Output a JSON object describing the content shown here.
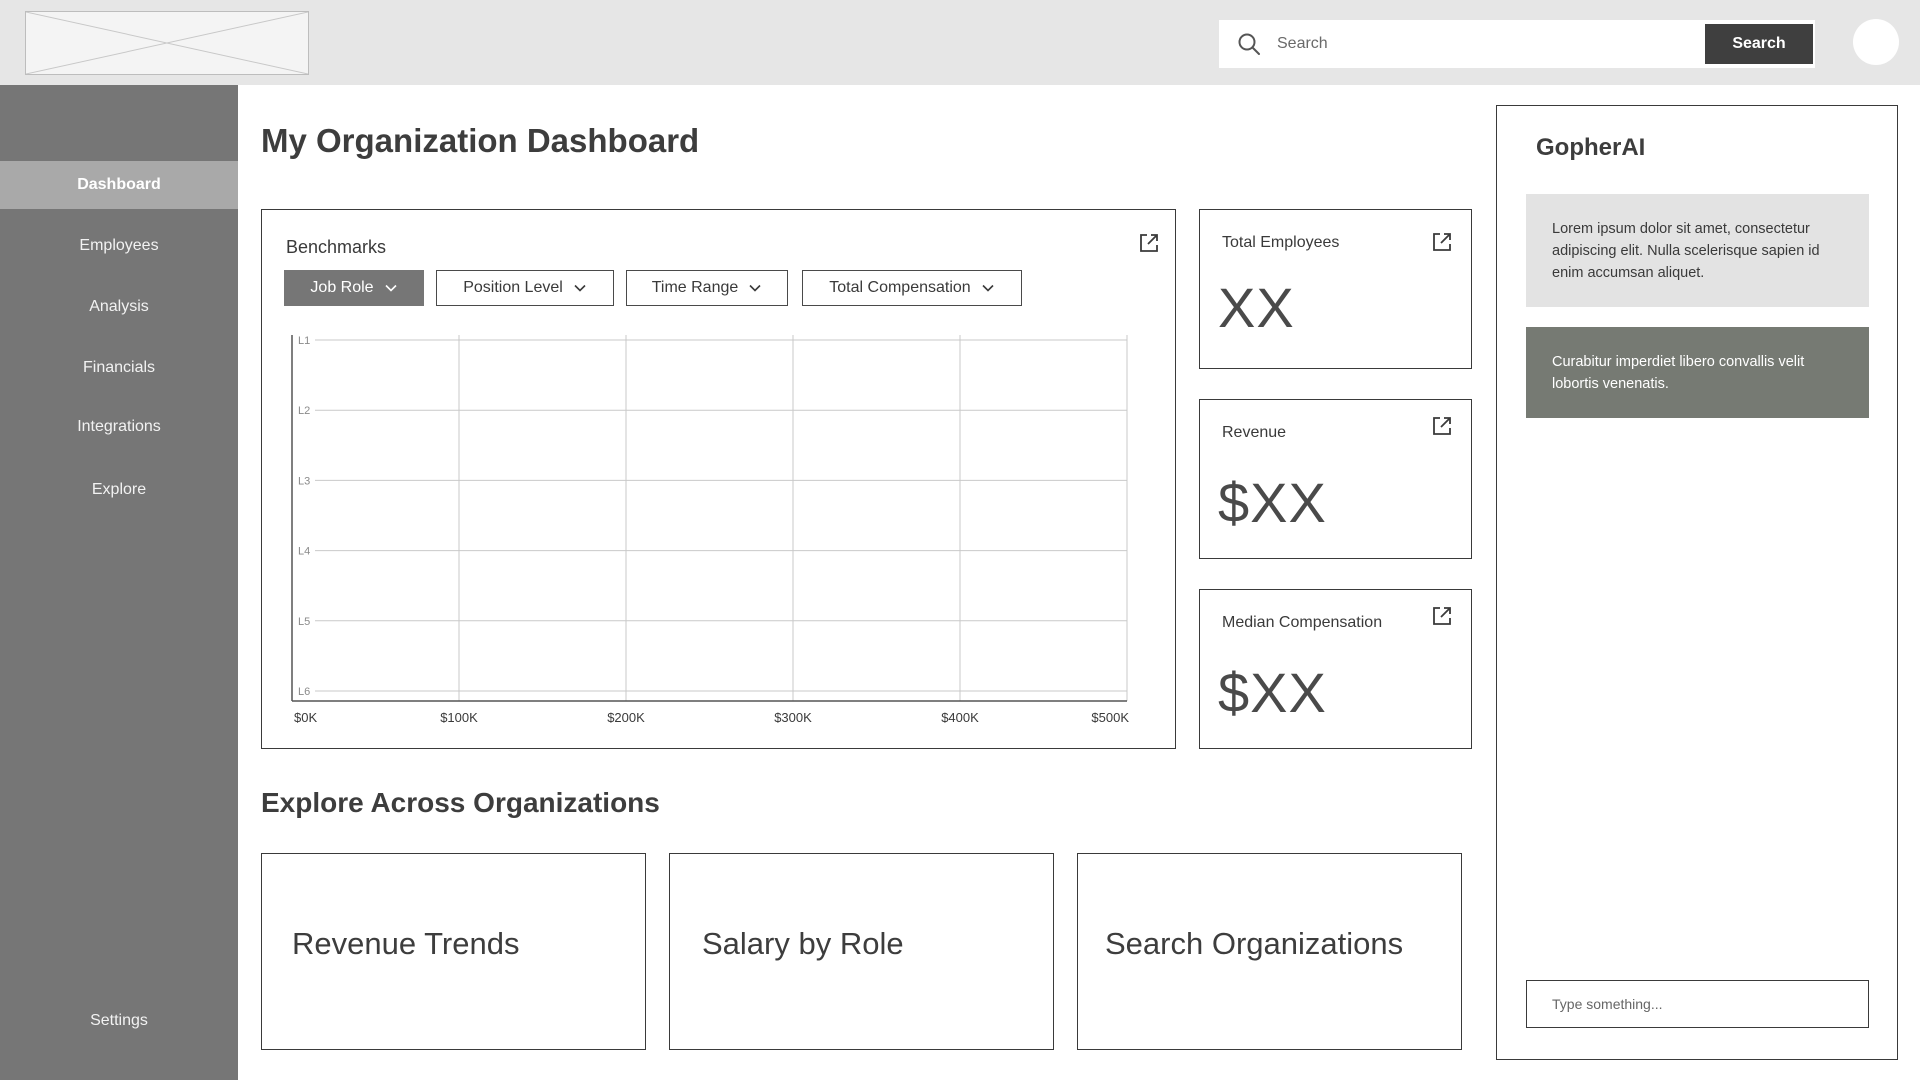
{
  "header": {
    "search_placeholder": "Search",
    "search_button": "Search"
  },
  "sidebar": {
    "items": [
      {
        "label": "Dashboard",
        "active": true
      },
      {
        "label": "Employees"
      },
      {
        "label": "Analysis"
      },
      {
        "label": "Financials"
      },
      {
        "label": "Integrations"
      },
      {
        "label": "Explore"
      }
    ],
    "settings": "Settings"
  },
  "main": {
    "title": "My Organization Dashboard",
    "benchmarks": {
      "title": "Benchmarks",
      "filters": [
        "Job Role",
        "Position Level",
        "Time Range",
        "Total Compensation"
      ]
    },
    "kpis": [
      {
        "title": "Total Employees",
        "value": "XX"
      },
      {
        "title": "Revenue",
        "value": "$XX"
      },
      {
        "title": "Median Compensation",
        "value": "$XX"
      }
    ],
    "explore": {
      "title": "Explore Across Organizations",
      "cards": [
        "Revenue Trends",
        "Salary by Role",
        "Search Organizations"
      ]
    }
  },
  "chat": {
    "title": "GopherAI",
    "messages": [
      "Lorem ipsum dolor sit amet, consectetur adipiscing elit. Nulla scelerisque sapien id enim accumsan aliquet.",
      "Curabitur imperdiet libero convallis velit lobortis venenatis."
    ],
    "input_placeholder": "Type something..."
  },
  "chart_data": {
    "type": "scatter",
    "x_tick_labels": [
      "$0K",
      "$100K",
      "$200K",
      "$300K",
      "$400K",
      "$500K"
    ],
    "y_tick_labels": [
      "L1",
      "L2",
      "L3",
      "L4",
      "L5",
      "L6"
    ],
    "xlim": [
      0,
      500
    ],
    "grid": true,
    "series": []
  },
  "colors": {
    "sidebar_bg": "#767676",
    "active_nav": "#a9a9a9",
    "header_bg": "#e6e6e6",
    "button_dark": "#3f3f3f"
  }
}
